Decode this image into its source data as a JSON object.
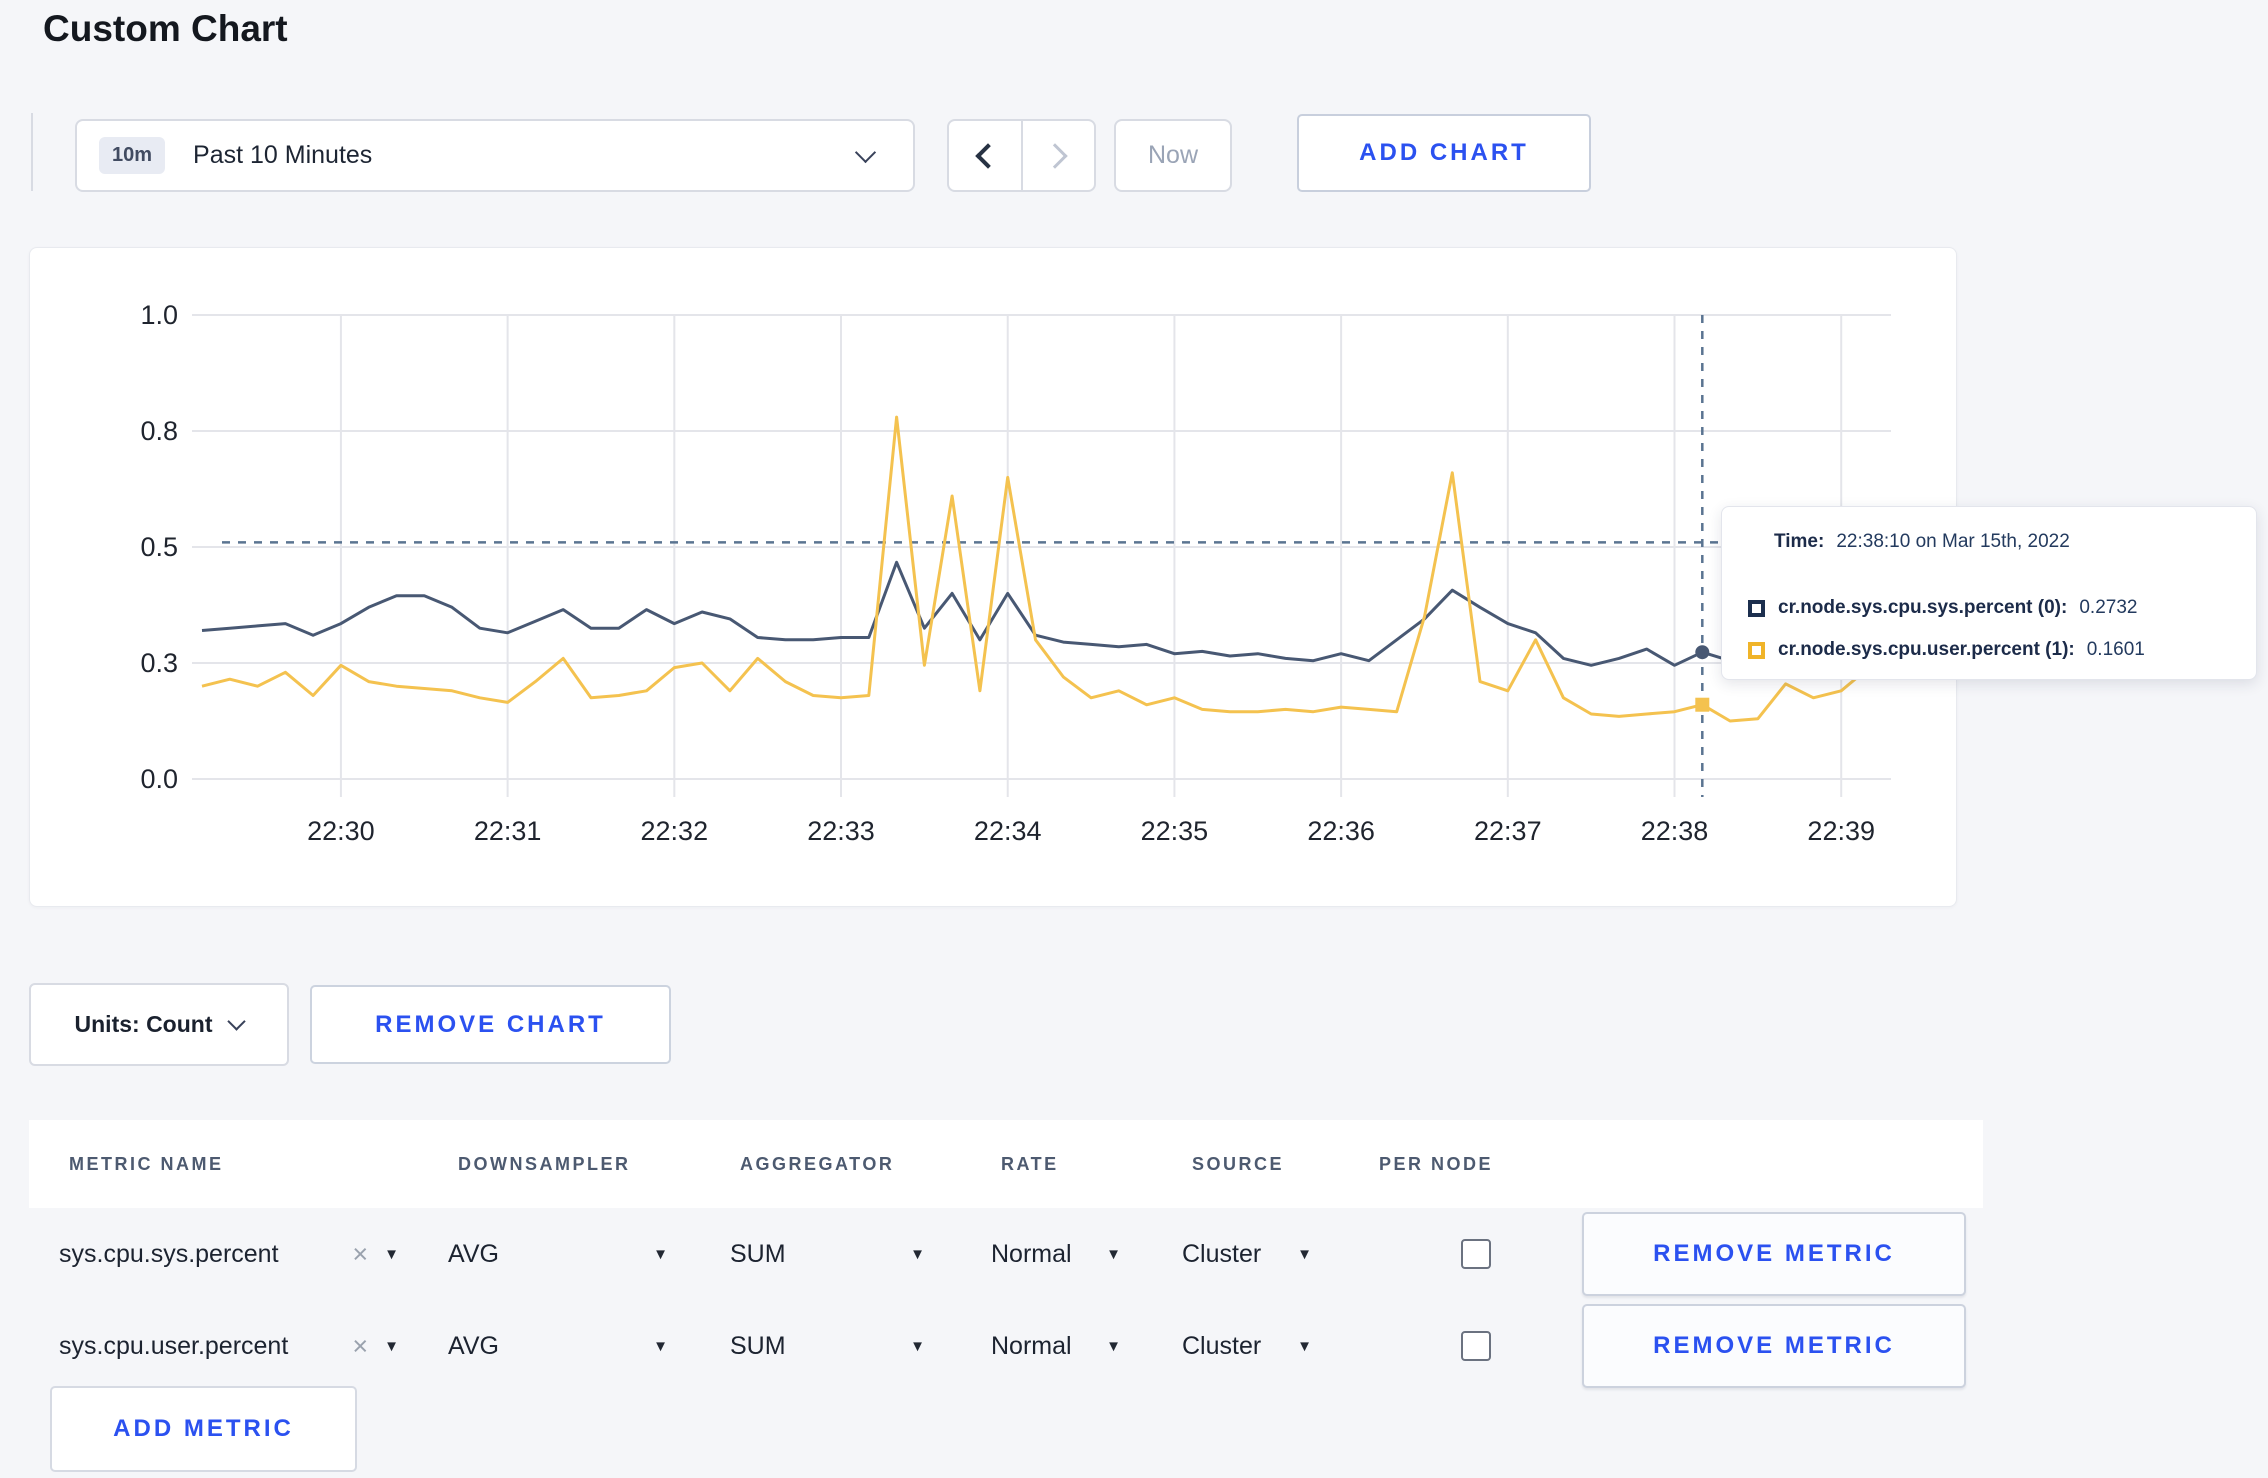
{
  "title": "Custom Chart",
  "controls": {
    "time_badge": "10m",
    "time_label": "Past 10 Minutes",
    "prev_icon": "chevron-left",
    "next_icon": "chevron-right",
    "now_label": "Now",
    "add_chart_label": "ADD CHART"
  },
  "chart_data": {
    "type": "line",
    "title": "",
    "xlabel": "",
    "ylabel": "",
    "ylim": [
      0,
      1.0
    ],
    "grid": true,
    "start_time": "22:29:10",
    "step_seconds": 10,
    "x_range_seconds": 600,
    "x_ticks": [
      {
        "label": "22:30",
        "t": 50
      },
      {
        "label": "22:31",
        "t": 110
      },
      {
        "label": "22:32",
        "t": 170
      },
      {
        "label": "22:33",
        "t": 230
      },
      {
        "label": "22:34",
        "t": 290
      },
      {
        "label": "22:35",
        "t": 350
      },
      {
        "label": "22:36",
        "t": 410
      },
      {
        "label": "22:37",
        "t": 470
      },
      {
        "label": "22:38",
        "t": 530
      },
      {
        "label": "22:39",
        "t": 590
      }
    ],
    "y_ticks": [
      {
        "label": "0.0",
        "v": 0
      },
      {
        "label": "0.3",
        "v": 0.25
      },
      {
        "label": "0.5",
        "v": 0.5
      },
      {
        "label": "0.8",
        "v": 0.75
      },
      {
        "label": "1.0",
        "v": 1.0
      }
    ],
    "series": [
      {
        "name": "cr.node.sys.cpu.sys.percent (0)",
        "color": "#485873",
        "values": [
          0.32,
          0.325,
          0.33,
          0.335,
          0.31,
          0.335,
          0.37,
          0.395,
          0.395,
          0.37,
          0.325,
          0.315,
          0.34,
          0.365,
          0.325,
          0.325,
          0.365,
          0.335,
          0.36,
          0.345,
          0.305,
          0.3,
          0.3,
          0.305,
          0.305,
          0.467,
          0.325,
          0.4,
          0.3,
          0.4,
          0.31,
          0.295,
          0.29,
          0.285,
          0.29,
          0.27,
          0.275,
          0.265,
          0.27,
          0.26,
          0.255,
          0.27,
          0.255,
          0.3,
          0.345,
          0.407,
          0.37,
          0.335,
          0.315,
          0.26,
          0.245,
          0.26,
          0.28,
          0.245,
          0.2732,
          0.255,
          0.265,
          0.28,
          0.27,
          0.28,
          0.285
        ]
      },
      {
        "name": "cr.node.sys.cpu.user.percent (1)",
        "color": "#f4c24f",
        "values": [
          0.2,
          0.215,
          0.2,
          0.23,
          0.18,
          0.245,
          0.21,
          0.2,
          0.195,
          0.19,
          0.175,
          0.165,
          0.21,
          0.26,
          0.175,
          0.18,
          0.19,
          0.24,
          0.25,
          0.19,
          0.26,
          0.21,
          0.18,
          0.175,
          0.18,
          0.78,
          0.245,
          0.61,
          0.19,
          0.65,
          0.3,
          0.22,
          0.175,
          0.19,
          0.16,
          0.175,
          0.15,
          0.145,
          0.145,
          0.15,
          0.145,
          0.155,
          0.15,
          0.145,
          0.35,
          0.66,
          0.21,
          0.19,
          0.3,
          0.175,
          0.14,
          0.135,
          0.14,
          0.145,
          0.1601,
          0.125,
          0.13,
          0.205,
          0.175,
          0.19,
          0.24
        ]
      }
    ],
    "crosshair": {
      "t": 540,
      "v": 0.51,
      "color": "#5a7491"
    },
    "markers": [
      {
        "series": 0,
        "t": 540,
        "value": 0.2732,
        "shape": "circle"
      },
      {
        "series": 1,
        "t": 540,
        "value": 0.1601,
        "shape": "square"
      }
    ]
  },
  "tooltip": {
    "time_label": "Time:",
    "time_value": "22:38:10 on Mar 15th, 2022",
    "rows": [
      {
        "swatch_color": "#1c2f4e",
        "label": "cr.node.sys.cpu.sys.percent (0):",
        "value": "0.2732"
      },
      {
        "swatch_color": "#f0b429",
        "label": "cr.node.sys.cpu.user.percent (1):",
        "value": "0.1601"
      }
    ]
  },
  "units": {
    "label": "Units: Count",
    "remove_chart_label": "REMOVE CHART"
  },
  "metrics": {
    "columns": [
      "METRIC NAME",
      "DOWNSAMPLER",
      "AGGREGATOR",
      "RATE",
      "SOURCE",
      "PER NODE"
    ],
    "rows": [
      {
        "metric_name": "sys.cpu.sys.percent",
        "downsampler": "AVG",
        "aggregator": "SUM",
        "rate": "Normal",
        "source": "Cluster",
        "per_node_checked": false,
        "remove_label": "REMOVE METRIC"
      },
      {
        "metric_name": "sys.cpu.user.percent",
        "downsampler": "AVG",
        "aggregator": "SUM",
        "rate": "Normal",
        "source": "Cluster",
        "per_node_checked": false,
        "remove_label": "REMOVE METRIC"
      }
    ],
    "add_metric_label": "ADD METRIC"
  },
  "colors": {
    "accent_blue": "#2b51f0",
    "page_bg": "#f5f6f9",
    "gridline": "#e4e5ea",
    "tick_text": "#1f242e"
  }
}
